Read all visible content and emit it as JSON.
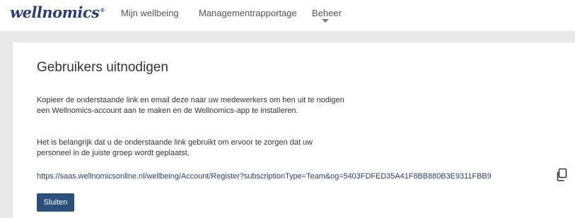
{
  "header": {
    "logo_text": "wellnomics",
    "logo_mark": "®",
    "nav": [
      {
        "label": "Mijn wellbeing"
      },
      {
        "label": "Managementrapportage"
      },
      {
        "label": "Beheer"
      }
    ],
    "dropdown_icon": "caret-down-icon"
  },
  "panel": {
    "title": "Gebruikers uitnodigen",
    "paragraph1": "Kopieer de onderstaande link en email deze naar uw medewerkers om hen uit te nodigen een Wellnomics-account aan te maken en de Wellnomics-app te installeren.",
    "paragraph2": "Het is belangrijk dat u de onderstaande link gebruikt om ervoor te zorgen dat uw personeel in de juiste groep wordt geplaatst.",
    "invite_link": "https://saas.wellnomicsonline.nl/wellbeing/Account/Register?subscriptionType=Team&og=5403FDFED35A41F8BB880B3E9311FBB9",
    "copy_icon": "copy-icon",
    "close_label": "Sluiten"
  },
  "colors": {
    "brand": "#2b3f6f",
    "button": "#2d4f7c",
    "background": "#e8e8e8"
  }
}
